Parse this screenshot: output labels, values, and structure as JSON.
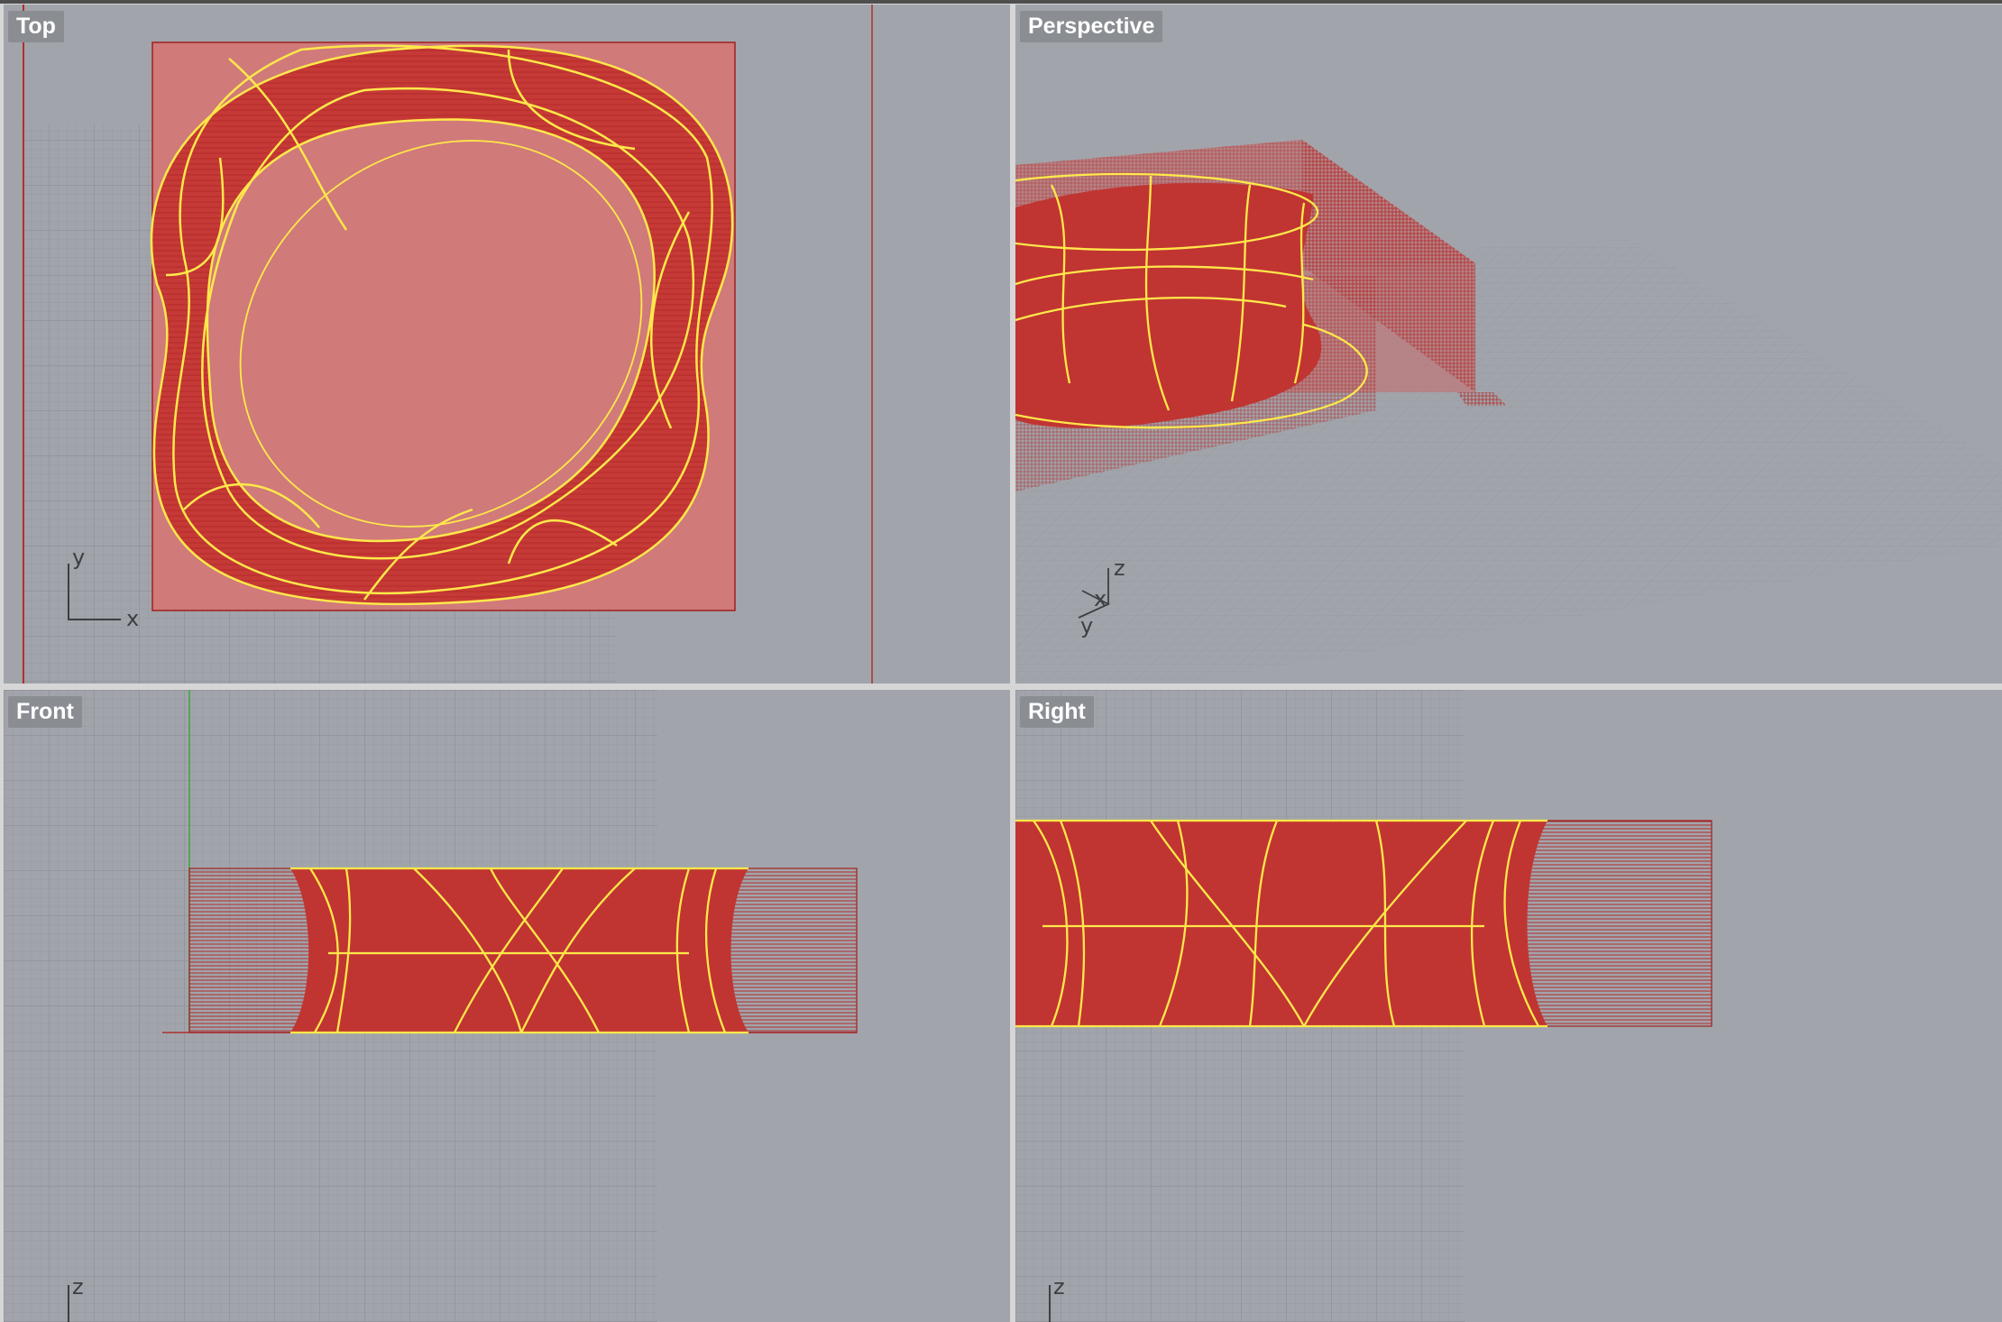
{
  "viewports": {
    "top": {
      "label": "Top",
      "axes": {
        "y": "y",
        "x": "x"
      }
    },
    "perspective": {
      "label": "Perspective",
      "axes": {
        "z": "z",
        "x": "x",
        "y": "y"
      }
    },
    "front": {
      "label": "Front",
      "axes": {
        "z": "z"
      }
    },
    "right": {
      "label": "Right",
      "axes": {
        "z": "z"
      }
    }
  },
  "colors": {
    "viewport_bg": "#a1a5ab",
    "grid_minor": "#969aa0",
    "grid_major": "#8a8e94",
    "object_fill": "#c53a36",
    "object_transparent": "#d07a7a",
    "selection_curve": "#ffe84a",
    "axis_x": "#b03030",
    "axis_y": "#3aa83a"
  }
}
